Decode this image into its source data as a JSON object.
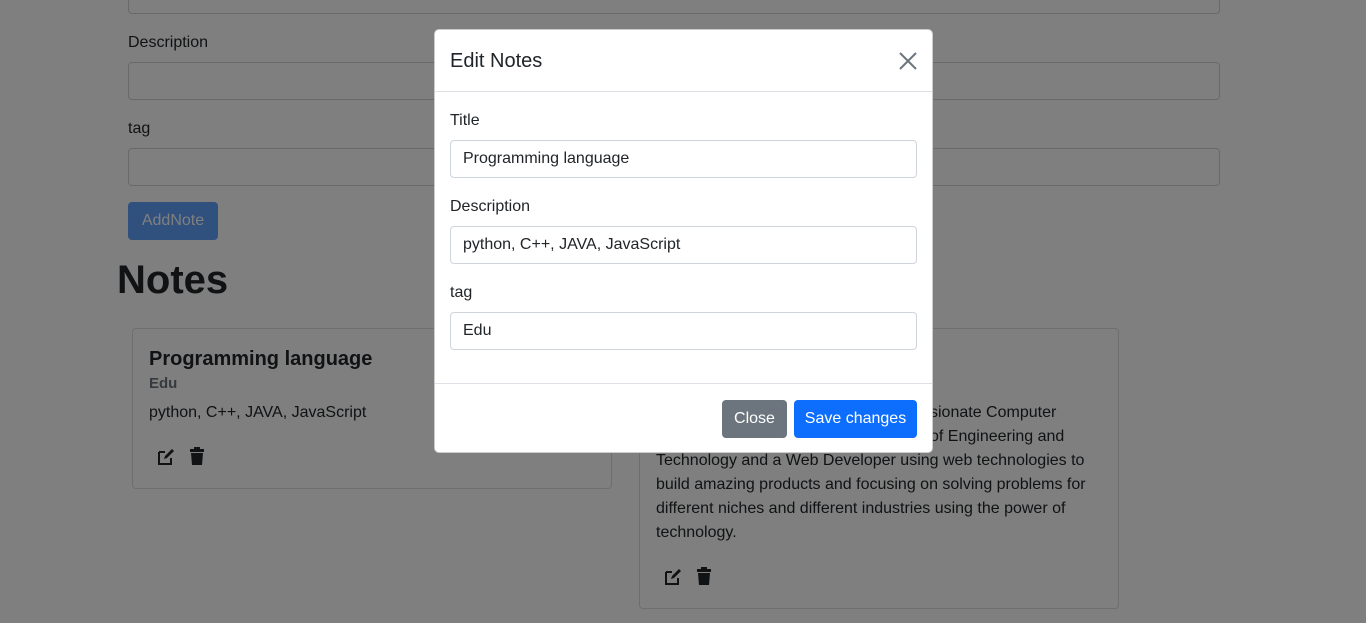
{
  "form": {
    "description_label": "Description",
    "tag_label": "tag",
    "add_button": "AddNote"
  },
  "notes_heading": "Notes",
  "cards": [
    {
      "title": "Programming language",
      "tag": "Edu",
      "description": "python, C++, JAVA, JavaScript"
    },
    {
      "visible_text_lines": [
        "sionate Computer",
        "of Engineering and",
        "Technology and a Web Developer using web technologies to",
        "build amazing products and focusing on solving problems for",
        "different niches and different industries using the power of",
        "technology."
      ]
    }
  ],
  "icons": {
    "edit": "edit-icon",
    "delete": "trash-icon",
    "close": "close-icon"
  },
  "modal": {
    "title": "Edit Notes",
    "title_label": "Title",
    "title_value": "Programming language",
    "description_label": "Description",
    "description_value": "python, C++, JAVA, JavaScript",
    "tag_label": "tag",
    "tag_value": "Edu",
    "close_button": "Close",
    "save_button": "Save changes"
  },
  "colors": {
    "primary": "#0d6efd",
    "secondary": "#6c757d",
    "backdrop": "rgba(0,0,0,0.5)"
  }
}
